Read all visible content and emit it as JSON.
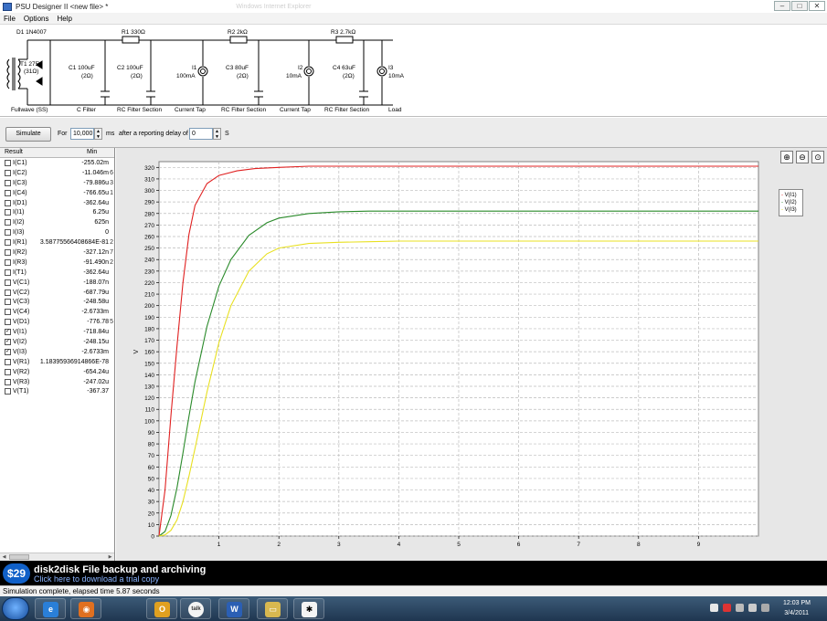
{
  "window": {
    "title": "PSU Designer II  <new file> *",
    "ghost_title": "Windows Internet Explorer"
  },
  "menu": [
    "File",
    "Options",
    "Help"
  ],
  "schematic": {
    "diode": "D1 1N4007",
    "transformer": "T1 275V",
    "transformer_r": "(31Ω)",
    "r1": "R1 330Ω",
    "r2": "R2 2kΩ",
    "r3": "R3 2.7kΩ",
    "c1": "C1 100uF",
    "c1r": "(2Ω)",
    "c2": "C2 100uF",
    "c2r": "(2Ω)",
    "c3": "C3 80uF",
    "c3r": "(2Ω)",
    "c4": "C4 63uF",
    "c4r": "(2Ω)",
    "i1": "I1",
    "i1v": "100mA",
    "i2": "I2",
    "i2v": "10mA",
    "i3": "I3",
    "i3v": "10mA",
    "stages": [
      "Fullwave (SS)",
      "C Filter",
      "RC Filter Section",
      "Current Tap",
      "RC Filter Section",
      "Current Tap",
      "RC Filter Section",
      "Load"
    ]
  },
  "controls": {
    "simulate_label": "Simulate",
    "for_label": "For",
    "duration_value": "10,000",
    "ms_label": "ms",
    "delay_label": "after a reporting delay of",
    "delay_value": "0",
    "s_label": "S"
  },
  "results": {
    "col_result": "Result",
    "col_min": "Min",
    "rows": [
      {
        "name": "I(C1)",
        "min": "-255.02m",
        "checked": false
      },
      {
        "name": "I(C2)",
        "min": "-11.046m",
        "overflow": "6",
        "checked": false
      },
      {
        "name": "I(C3)",
        "min": "-79.886u",
        "overflow": "3",
        "checked": false
      },
      {
        "name": "I(C4)",
        "min": "-766.65u",
        "overflow": "1",
        "checked": false
      },
      {
        "name": "I(D1)",
        "min": "-362.64u",
        "checked": false
      },
      {
        "name": "I(I1)",
        "min": "6.25u",
        "checked": false
      },
      {
        "name": "I(I2)",
        "min": "625n",
        "checked": false
      },
      {
        "name": "I(I3)",
        "min": "0",
        "checked": false
      },
      {
        "name": "I(R1)",
        "min": "3.587755664086​84E-81",
        "overflow": "2",
        "checked": false
      },
      {
        "name": "I(R2)",
        "min": "-327.12n",
        "overflow": "7",
        "checked": false
      },
      {
        "name": "I(R3)",
        "min": "-91.490n",
        "overflow": "2",
        "checked": false
      },
      {
        "name": "I(T1)",
        "min": "-362.64u",
        "checked": false
      },
      {
        "name": "V(C1)",
        "min": "-188.07n",
        "checked": false
      },
      {
        "name": "V(C2)",
        "min": "-687.79u",
        "checked": false
      },
      {
        "name": "V(C3)",
        "min": "-248.58u",
        "checked": false
      },
      {
        "name": "V(C4)",
        "min": "-2.6733m",
        "checked": false
      },
      {
        "name": "V(D1)",
        "min": "-776.78",
        "overflow": "5",
        "checked": false
      },
      {
        "name": "V(I1)",
        "min": "-718.84u",
        "checked": true
      },
      {
        "name": "V(I2)",
        "min": "-248.15u",
        "checked": true
      },
      {
        "name": "V(I3)",
        "min": "-2.6733m",
        "checked": true
      },
      {
        "name": "V(R1)",
        "min": "1.18395936914866E-78",
        "checked": false
      },
      {
        "name": "V(R2)",
        "min": "-654.24u",
        "checked": false
      },
      {
        "name": "V(R3)",
        "min": "-247.02u",
        "checked": false
      },
      {
        "name": "V(T1)",
        "min": "-367.37",
        "checked": false
      }
    ]
  },
  "chart_data": {
    "type": "line",
    "ylabel": "V",
    "xlim": [
      0,
      10
    ],
    "ylim": [
      0,
      325
    ],
    "x_ticks": [
      1,
      2,
      3,
      4,
      5,
      6,
      7,
      8,
      9
    ],
    "y_ticks": [
      0,
      10,
      20,
      30,
      40,
      50,
      60,
      70,
      80,
      90,
      100,
      110,
      120,
      130,
      140,
      150,
      160,
      170,
      180,
      190,
      200,
      210,
      220,
      230,
      240,
      250,
      260,
      270,
      280,
      290,
      300,
      310,
      320
    ],
    "grid": true,
    "legend_position": "top-right",
    "series": [
      {
        "name": "V(I1)",
        "color": "#e02020",
        "x": [
          0,
          0.1,
          0.2,
          0.3,
          0.4,
          0.5,
          0.6,
          0.8,
          1.0,
          1.3,
          1.6,
          2.0,
          2.5,
          3.0,
          4,
          5,
          6,
          7,
          8,
          9,
          10
        ],
        "y": [
          0,
          40,
          105,
          165,
          220,
          262,
          287,
          306,
          313,
          317,
          319,
          320,
          321,
          321,
          321,
          321,
          321,
          321,
          321,
          321,
          321
        ]
      },
      {
        "name": "V(I2)",
        "color": "#2a8a2a",
        "x": [
          0,
          0.1,
          0.2,
          0.3,
          0.4,
          0.5,
          0.6,
          0.8,
          1.0,
          1.2,
          1.5,
          1.8,
          2.0,
          2.5,
          3.0,
          3.5,
          4,
          5,
          6,
          7,
          8,
          9,
          10
        ],
        "y": [
          0,
          4,
          18,
          42,
          72,
          104,
          134,
          182,
          217,
          240,
          261,
          272,
          276,
          280,
          281.5,
          282,
          282,
          282,
          282,
          282,
          282,
          282,
          282
        ]
      },
      {
        "name": "V(I3)",
        "color": "#e8e020",
        "x": [
          0,
          0.1,
          0.2,
          0.3,
          0.4,
          0.5,
          0.6,
          0.8,
          1.0,
          1.2,
          1.5,
          1.8,
          2.0,
          2.5,
          3.0,
          3.5,
          4,
          5,
          6,
          7,
          8,
          9,
          10
        ],
        "y": [
          0,
          1,
          5,
          14,
          30,
          52,
          76,
          125,
          168,
          200,
          230,
          245,
          250,
          254,
          255,
          255.5,
          256,
          256,
          256,
          256,
          256,
          256,
          256
        ]
      }
    ]
  },
  "ad": {
    "badge": "$29",
    "title": "disk2disk File backup and archiving",
    "subtitle": "Click here to download a trial copy"
  },
  "status": {
    "text": "Simulation complete, elapsed time 5.87 seconds"
  },
  "taskbar": {
    "apps": [
      {
        "icon": "ie-icon",
        "glyph": "e",
        "color": "#2a7fd8"
      },
      {
        "icon": "firefox-icon",
        "glyph": "◉",
        "color": "#e07020"
      },
      {
        "icon": "outlook-icon",
        "glyph": "O",
        "color": "#e0a020"
      },
      {
        "icon": "gtalk-icon",
        "glyph": "talk",
        "color": "#9acd32"
      },
      {
        "icon": "word-icon",
        "glyph": "W",
        "color": "#2b5fb4"
      },
      {
        "icon": "explorer-icon",
        "glyph": "▭",
        "color": "#d8b850"
      },
      {
        "icon": "psu-icon",
        "glyph": "✱",
        "color": "#f4f4f4"
      }
    ],
    "time": "12:03 PM",
    "date": "3/4/2011"
  }
}
